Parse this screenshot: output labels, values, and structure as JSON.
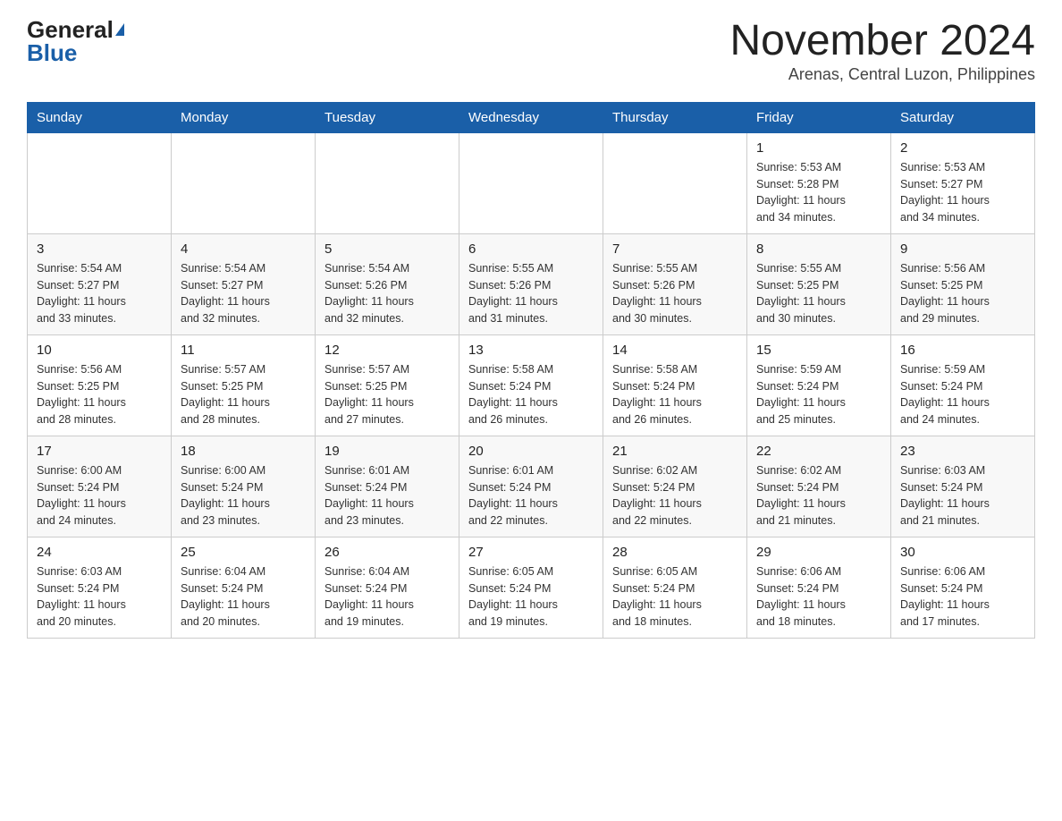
{
  "header": {
    "logo_general": "General",
    "logo_blue": "Blue",
    "month_title": "November 2024",
    "location": "Arenas, Central Luzon, Philippines"
  },
  "calendar": {
    "days_of_week": [
      "Sunday",
      "Monday",
      "Tuesday",
      "Wednesday",
      "Thursday",
      "Friday",
      "Saturday"
    ],
    "weeks": [
      [
        {
          "day": "",
          "info": ""
        },
        {
          "day": "",
          "info": ""
        },
        {
          "day": "",
          "info": ""
        },
        {
          "day": "",
          "info": ""
        },
        {
          "day": "",
          "info": ""
        },
        {
          "day": "1",
          "info": "Sunrise: 5:53 AM\nSunset: 5:28 PM\nDaylight: 11 hours\nand 34 minutes."
        },
        {
          "day": "2",
          "info": "Sunrise: 5:53 AM\nSunset: 5:27 PM\nDaylight: 11 hours\nand 34 minutes."
        }
      ],
      [
        {
          "day": "3",
          "info": "Sunrise: 5:54 AM\nSunset: 5:27 PM\nDaylight: 11 hours\nand 33 minutes."
        },
        {
          "day": "4",
          "info": "Sunrise: 5:54 AM\nSunset: 5:27 PM\nDaylight: 11 hours\nand 32 minutes."
        },
        {
          "day": "5",
          "info": "Sunrise: 5:54 AM\nSunset: 5:26 PM\nDaylight: 11 hours\nand 32 minutes."
        },
        {
          "day": "6",
          "info": "Sunrise: 5:55 AM\nSunset: 5:26 PM\nDaylight: 11 hours\nand 31 minutes."
        },
        {
          "day": "7",
          "info": "Sunrise: 5:55 AM\nSunset: 5:26 PM\nDaylight: 11 hours\nand 30 minutes."
        },
        {
          "day": "8",
          "info": "Sunrise: 5:55 AM\nSunset: 5:25 PM\nDaylight: 11 hours\nand 30 minutes."
        },
        {
          "day": "9",
          "info": "Sunrise: 5:56 AM\nSunset: 5:25 PM\nDaylight: 11 hours\nand 29 minutes."
        }
      ],
      [
        {
          "day": "10",
          "info": "Sunrise: 5:56 AM\nSunset: 5:25 PM\nDaylight: 11 hours\nand 28 minutes."
        },
        {
          "day": "11",
          "info": "Sunrise: 5:57 AM\nSunset: 5:25 PM\nDaylight: 11 hours\nand 28 minutes."
        },
        {
          "day": "12",
          "info": "Sunrise: 5:57 AM\nSunset: 5:25 PM\nDaylight: 11 hours\nand 27 minutes."
        },
        {
          "day": "13",
          "info": "Sunrise: 5:58 AM\nSunset: 5:24 PM\nDaylight: 11 hours\nand 26 minutes."
        },
        {
          "day": "14",
          "info": "Sunrise: 5:58 AM\nSunset: 5:24 PM\nDaylight: 11 hours\nand 26 minutes."
        },
        {
          "day": "15",
          "info": "Sunrise: 5:59 AM\nSunset: 5:24 PM\nDaylight: 11 hours\nand 25 minutes."
        },
        {
          "day": "16",
          "info": "Sunrise: 5:59 AM\nSunset: 5:24 PM\nDaylight: 11 hours\nand 24 minutes."
        }
      ],
      [
        {
          "day": "17",
          "info": "Sunrise: 6:00 AM\nSunset: 5:24 PM\nDaylight: 11 hours\nand 24 minutes."
        },
        {
          "day": "18",
          "info": "Sunrise: 6:00 AM\nSunset: 5:24 PM\nDaylight: 11 hours\nand 23 minutes."
        },
        {
          "day": "19",
          "info": "Sunrise: 6:01 AM\nSunset: 5:24 PM\nDaylight: 11 hours\nand 23 minutes."
        },
        {
          "day": "20",
          "info": "Sunrise: 6:01 AM\nSunset: 5:24 PM\nDaylight: 11 hours\nand 22 minutes."
        },
        {
          "day": "21",
          "info": "Sunrise: 6:02 AM\nSunset: 5:24 PM\nDaylight: 11 hours\nand 22 minutes."
        },
        {
          "day": "22",
          "info": "Sunrise: 6:02 AM\nSunset: 5:24 PM\nDaylight: 11 hours\nand 21 minutes."
        },
        {
          "day": "23",
          "info": "Sunrise: 6:03 AM\nSunset: 5:24 PM\nDaylight: 11 hours\nand 21 minutes."
        }
      ],
      [
        {
          "day": "24",
          "info": "Sunrise: 6:03 AM\nSunset: 5:24 PM\nDaylight: 11 hours\nand 20 minutes."
        },
        {
          "day": "25",
          "info": "Sunrise: 6:04 AM\nSunset: 5:24 PM\nDaylight: 11 hours\nand 20 minutes."
        },
        {
          "day": "26",
          "info": "Sunrise: 6:04 AM\nSunset: 5:24 PM\nDaylight: 11 hours\nand 19 minutes."
        },
        {
          "day": "27",
          "info": "Sunrise: 6:05 AM\nSunset: 5:24 PM\nDaylight: 11 hours\nand 19 minutes."
        },
        {
          "day": "28",
          "info": "Sunrise: 6:05 AM\nSunset: 5:24 PM\nDaylight: 11 hours\nand 18 minutes."
        },
        {
          "day": "29",
          "info": "Sunrise: 6:06 AM\nSunset: 5:24 PM\nDaylight: 11 hours\nand 18 minutes."
        },
        {
          "day": "30",
          "info": "Sunrise: 6:06 AM\nSunset: 5:24 PM\nDaylight: 11 hours\nand 17 minutes."
        }
      ]
    ]
  }
}
